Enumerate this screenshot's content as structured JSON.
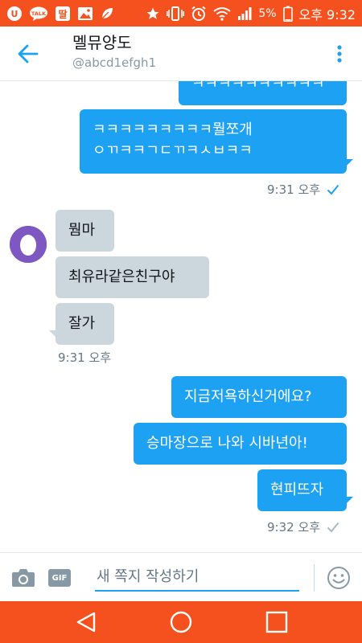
{
  "status_bar": {
    "left_icons": [
      "u-plus-icon",
      "kakaotalk-icon",
      "ttal-app-icon",
      "image-icon",
      "leaf-icon"
    ],
    "talk_badge": "TALK",
    "ttal_badge": "딸",
    "u_badge": "U",
    "battery": "5%",
    "time": "오후 9:32"
  },
  "header": {
    "title": "멜뮤양도",
    "handle": "@abcd1efgh1"
  },
  "messages": [
    {
      "id": "m1",
      "direction": "outgoing",
      "text": "ㅋㅋㅋㅋㅋㅋㅋㅋㅋㅋ"
    },
    {
      "id": "m2",
      "direction": "outgoing",
      "lines": [
        "ㅋㅋㅋㅋㅋㅋㅋㅋㅋ뭘쪼개",
        "ㅇㄲㅋㅋㄱㄷㄲㅋㅅㅂㅋㅋ"
      ]
    },
    {
      "id": "m3",
      "direction": "incoming",
      "text": "뭠마"
    },
    {
      "id": "m4",
      "direction": "incoming",
      "text": "최유라같은친구야"
    },
    {
      "id": "m5",
      "direction": "incoming",
      "text": "잘가"
    },
    {
      "id": "m6",
      "direction": "outgoing",
      "text": "지금저욕하신거에요?"
    },
    {
      "id": "m7",
      "direction": "outgoing",
      "text": "승마장으로 나와 시바년아!"
    },
    {
      "id": "m8",
      "direction": "outgoing",
      "text": "현피뜨자"
    }
  ],
  "timestamps": {
    "out_1": "9:31 오후",
    "in_1": "9:31 오후",
    "out_2": "9:32 오후"
  },
  "composer": {
    "placeholder": "새 쪽지 작성하기",
    "gif_label": "GIF"
  },
  "colors": {
    "accent": "#1da1f2",
    "status_bar": "#f4511e",
    "incoming_bubble": "#ccd6dd",
    "avatar": "#7e57c2"
  }
}
